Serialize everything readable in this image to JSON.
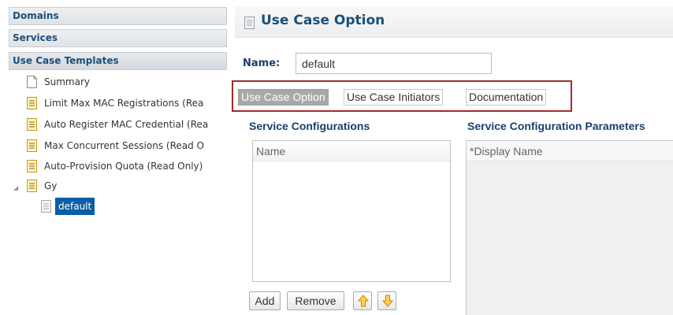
{
  "nav": {
    "sections": [
      "Domains",
      "Services",
      "Use Case Templates"
    ],
    "tree": [
      {
        "label": "Summary",
        "icon": "page-icon"
      },
      {
        "label": "Limit Max MAC Registrations (Rea",
        "icon": "document-icon"
      },
      {
        "label": "Auto Register MAC Credential (Rea",
        "icon": "document-icon"
      },
      {
        "label": "Max Concurrent Sessions (Read O",
        "icon": "document-icon"
      },
      {
        "label": "Auto-Provision Quota (Read Only)",
        "icon": "document-icon"
      },
      {
        "label": "Gy",
        "icon": "document-icon"
      }
    ],
    "selected_child": {
      "label": "default",
      "icon": "document-light-icon"
    }
  },
  "main": {
    "title": "Use Case Option",
    "name_label": "Name:",
    "name_value": "default",
    "tabs": [
      "Use Case Option",
      "Use Case Initiators",
      "Documentation"
    ],
    "active_tab": "Use Case Option",
    "service_config_title": "Service Configurations",
    "service_config_column": "Name",
    "param_title": "Service Configuration Parameters",
    "param_column": "*Display Name",
    "buttons": {
      "add": "Add",
      "remove": "Remove",
      "up_icon": "arrow-up-icon",
      "down_icon": "arrow-down-icon"
    }
  },
  "colors": {
    "accent_blue": "#1b4f78",
    "selected_bg": "#0b5ea5",
    "tab_outline": "#a52a2a",
    "arrow_icon": "#e6a000"
  }
}
